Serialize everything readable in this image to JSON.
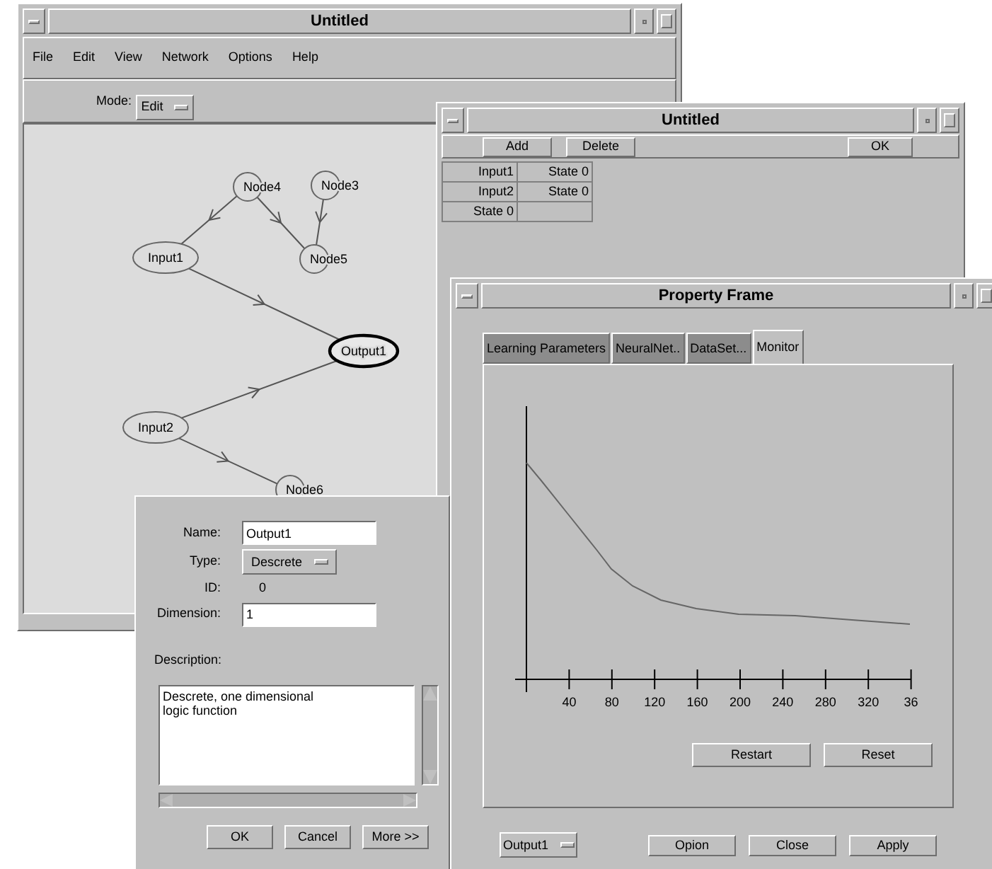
{
  "main_window": {
    "title": "Untitled",
    "menu": [
      "File",
      "Edit",
      "View",
      "Network",
      "Options",
      "Help"
    ],
    "mode_label": "Mode:",
    "mode_value": "Edit",
    "nodes": [
      {
        "label": "Node4",
        "selected": false
      },
      {
        "label": "Node3",
        "selected": false
      },
      {
        "label": "Input1",
        "selected": false
      },
      {
        "label": "Node5",
        "selected": false
      },
      {
        "label": "Output1",
        "selected": true
      },
      {
        "label": "Input2",
        "selected": false
      },
      {
        "label": "Node6",
        "selected": false
      }
    ]
  },
  "state_window": {
    "title": "Untitled",
    "buttons": [
      "Add",
      "Delete"
    ],
    "ok_button": "OK",
    "table_rows": [
      [
        "Input1",
        "State 0"
      ],
      [
        "Input2",
        "State 0"
      ],
      [
        "State 0"
      ]
    ]
  },
  "property_frame": {
    "title": "Property Frame",
    "tabs": [
      {
        "label": "Learning Parameters",
        "selected": false
      },
      {
        "label": "NeuralNet..",
        "selected": false
      },
      {
        "label": "DataSet...",
        "selected": false
      },
      {
        "label": "Monitor",
        "selected": true
      }
    ],
    "x_tick_labels": [
      "40",
      "80",
      "120",
      "160",
      "200",
      "240",
      "280",
      "320",
      "36"
    ],
    "panel_buttons": [
      "Restart",
      "Reset"
    ],
    "output_select": "Output1",
    "buttons": [
      "Opion",
      "Close",
      "Apply"
    ]
  },
  "node_dialog": {
    "name_label": "Name:",
    "name_value": "Output1",
    "type_label": "Type:",
    "type_value": "Descrete",
    "id_label": "ID:",
    "id_value": "0",
    "dimension_label": "Dimension:",
    "dimension_value": "1",
    "description_label": "Description:",
    "description_value": "Descrete, one dimensional\nlogic function",
    "buttons": [
      "OK",
      "Cancel",
      "More >>"
    ]
  }
}
